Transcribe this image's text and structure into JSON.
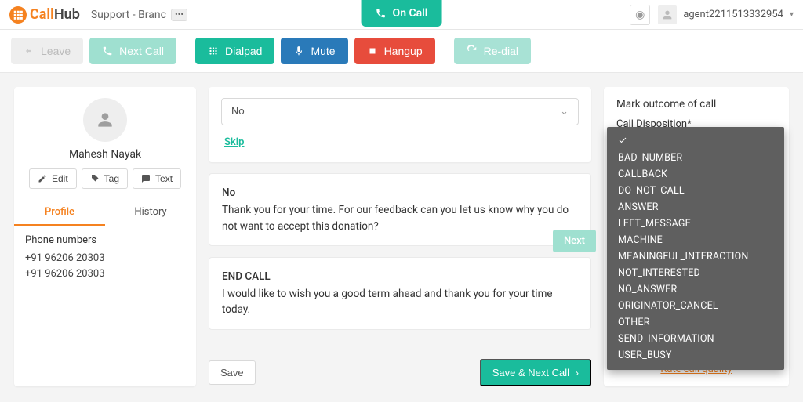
{
  "brand": {
    "prefix": "Call",
    "suffix": "Hub"
  },
  "campaign_name": "Support - Branc",
  "on_call": "On Call",
  "username": "agent2211513332954",
  "toolbar": {
    "leave": "Leave",
    "next_call": "Next Call",
    "dialpad": "Dialpad",
    "mute": "Mute",
    "hangup": "Hangup",
    "redial": "Re-dial"
  },
  "profile": {
    "name": "Mahesh Nayak",
    "edit": "Edit",
    "tag": "Tag",
    "text": "Text",
    "tab_profile": "Profile",
    "tab_history": "History",
    "phones_hdr": "Phone numbers",
    "phones": [
      "+91 96206 20303",
      "+91 96206 20303"
    ]
  },
  "script": {
    "answer_select": "No",
    "skip": "Skip",
    "block1_title": "No",
    "block1_body": "Thank you for your time.  For our feedback can you let us know why you do not want to accept this donation?",
    "next": "Next",
    "block2_title": "END CALL",
    "block2_body": "I would like to wish you a good term ahead and thank you for your time today.",
    "save": "Save",
    "save_next": "Save & Next Call"
  },
  "outcome": {
    "header": "Mark outcome of call",
    "label": "Call Disposition*",
    "rate": "Rate call quality",
    "options": [
      "BAD_NUMBER",
      "CALLBACK",
      "DO_NOT_CALL",
      "ANSWER",
      "LEFT_MESSAGE",
      "MACHINE",
      "MEANINGFUL_INTERACTION",
      "NOT_INTERESTED",
      "NO_ANSWER",
      "ORIGINATOR_CANCEL",
      "OTHER",
      "SEND_INFORMATION",
      "USER_BUSY"
    ]
  }
}
